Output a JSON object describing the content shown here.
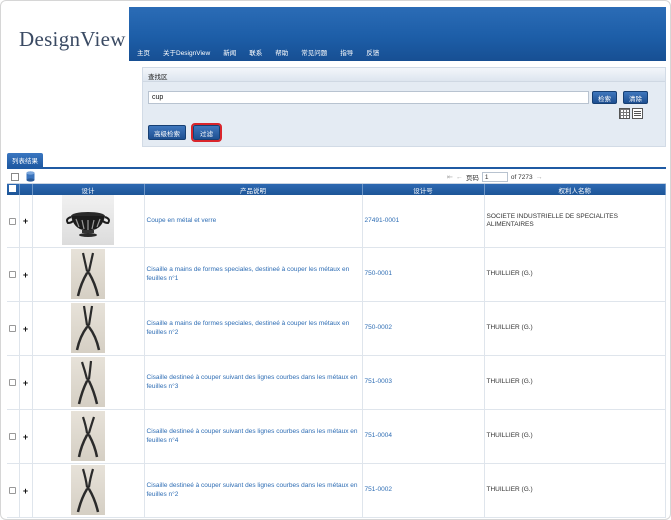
{
  "header": {
    "logo_text": "DesignView",
    "nav": [
      "主页",
      "关于DesignView",
      "新闻",
      "联系",
      "帮助",
      "常见问题",
      "指导",
      "反馈"
    ]
  },
  "search": {
    "panel_title": "查找区",
    "query_value": "cup",
    "search_label": "检索",
    "clear_label": "清除",
    "advanced_label": "高级检索",
    "filter_label": "过滤"
  },
  "results_tab": {
    "label": "列表结果"
  },
  "pager": {
    "page_label": "页码",
    "page_value": "1",
    "of_text": "of 7273"
  },
  "table": {
    "headers": [
      "设计",
      "产品说明",
      "设计号",
      "权利人名称"
    ],
    "rows": [
      {
        "description": "Coupe en métal et verre",
        "number": "27491-0001",
        "holder": "SOCIETE INDUSTRIELLE DE SPECIALITES ALIMENTAIRES",
        "image": "cup"
      },
      {
        "description": "Cisaille a mains de formes speciales, destineé à couper les métaux en feuilles n°1",
        "number": "750-0001",
        "holder": "THUILLIER (G.)",
        "image": "shear"
      },
      {
        "description": "Cisaille a mains de formes speciales, destineé à couper les métaux en feuilles n°2",
        "number": "750-0002",
        "holder": "THUILLIER (G.)",
        "image": "shear"
      },
      {
        "description": "Cisaille destineé à couper suivant des lignes courbes dans les métaux en feuilles n°3",
        "number": "751-0003",
        "holder": "THUILLIER (G.)",
        "image": "shear"
      },
      {
        "description": "Cisaille destineé à couper suivant des lignes courbes dans les métaux en feuilles n°4",
        "number": "751-0004",
        "holder": "THUILLIER (G.)",
        "image": "shear"
      },
      {
        "description": "Cisaille destineé à couper suivant des lignes courbes dans les métaux en feuilles n°2",
        "number": "751-0002",
        "holder": "THUILLIER (G.)",
        "image": "shear"
      }
    ]
  },
  "colors": {
    "banner_blue": "#1d5ea8",
    "link_blue": "#2e6db4",
    "filter_highlight": "#d9262c"
  }
}
